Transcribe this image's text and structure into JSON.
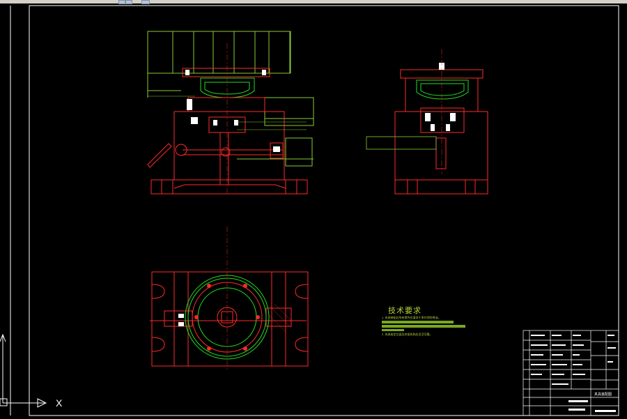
{
  "app": {
    "title": "",
    "theme": {
      "background": "#000000",
      "border_color": "#ffffff",
      "part_color": "#ff2a2a",
      "hidden_color": "#88cc33",
      "annotation_color": "#b6d23a",
      "green_detail": "#20e020"
    }
  },
  "drawing": {
    "tech_requirements": {
      "title": "技术要求",
      "lines": [
        "1. 夹具装配后所有零件应清洗干净并涂防锈油。",
        "2. 夹具各定位面及夹紧机构应灵活可靠。"
      ]
    },
    "title_block": {
      "drawing_name": "夹具装配图"
    },
    "ucs": {
      "x_label": "X"
    }
  }
}
